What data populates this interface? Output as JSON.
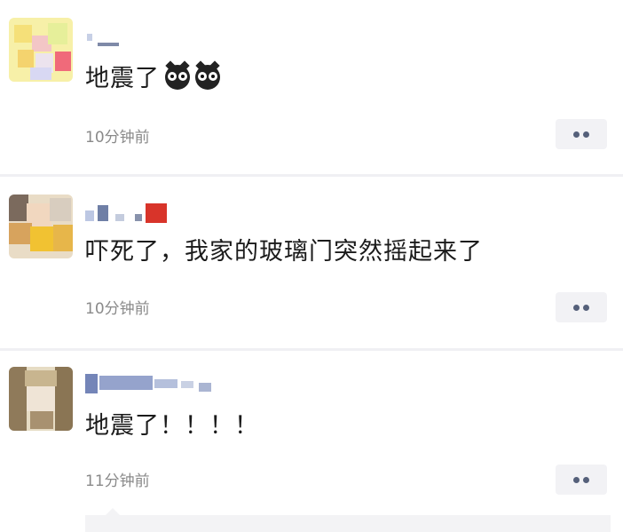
{
  "comments": [
    {
      "text": "地震了",
      "time": "10分钟前",
      "emoji_count": 2
    },
    {
      "text": "吓死了，我家的玻璃门突然摇起来了",
      "time": "10分钟前"
    },
    {
      "text": "地震了！！！！",
      "time": "11分钟前"
    }
  ],
  "icons": {
    "emoji": "owl-face-icon",
    "more": "more-dots-icon"
  },
  "colors": {
    "time": "#8a8a8a",
    "button_bg": "#f2f2f5",
    "dots": "#55607a",
    "divider": "#f0f0f3"
  }
}
